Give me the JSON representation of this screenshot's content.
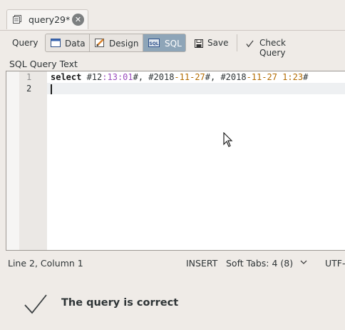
{
  "tab": {
    "title": "query29*",
    "icon": "query-tab-icon",
    "close_icon": "close-icon",
    "close_glyph": "✕"
  },
  "toolbar": {
    "query_label": "Query",
    "modes": [
      {
        "label": "Data",
        "icon": "data-grid-icon",
        "active": false
      },
      {
        "label": "Design",
        "icon": "design-pencil-icon",
        "active": false
      },
      {
        "label": "SQL",
        "icon": "sql-icon",
        "active": true
      }
    ],
    "save_label": "Save",
    "save_icon": "save-icon",
    "check_label": "Check Query",
    "check_icon": "check-query-icon"
  },
  "editor": {
    "section_label": "SQL Query Text",
    "line_numbers": [
      "1",
      "2"
    ],
    "current_line": 2,
    "lines": [
      {
        "tokens": [
          {
            "text": "select",
            "type": "keyword"
          },
          {
            "text": " #12",
            "type": "plain"
          },
          {
            "text": ":13:01",
            "type": "number"
          },
          {
            "text": "#, #2018",
            "type": "plain"
          },
          {
            "text": "-11-27",
            "type": "date"
          },
          {
            "text": "#, #2018",
            "type": "plain"
          },
          {
            "text": "-11-27 1:23",
            "type": "date"
          },
          {
            "text": "#",
            "type": "plain"
          }
        ]
      },
      {
        "tokens": []
      }
    ]
  },
  "statusbar": {
    "position": "Line 2, Column 1",
    "mode": "INSERT",
    "tabs": "Soft Tabs: 4 (8)",
    "encoding": "UTF-"
  },
  "result": {
    "message": "The query is correct",
    "icon": "checkmark-icon"
  },
  "colors": {
    "sql_active": "#8ea5b8",
    "background": "#efebe7",
    "number": "#9b4dbd",
    "date": "#b36b00"
  }
}
